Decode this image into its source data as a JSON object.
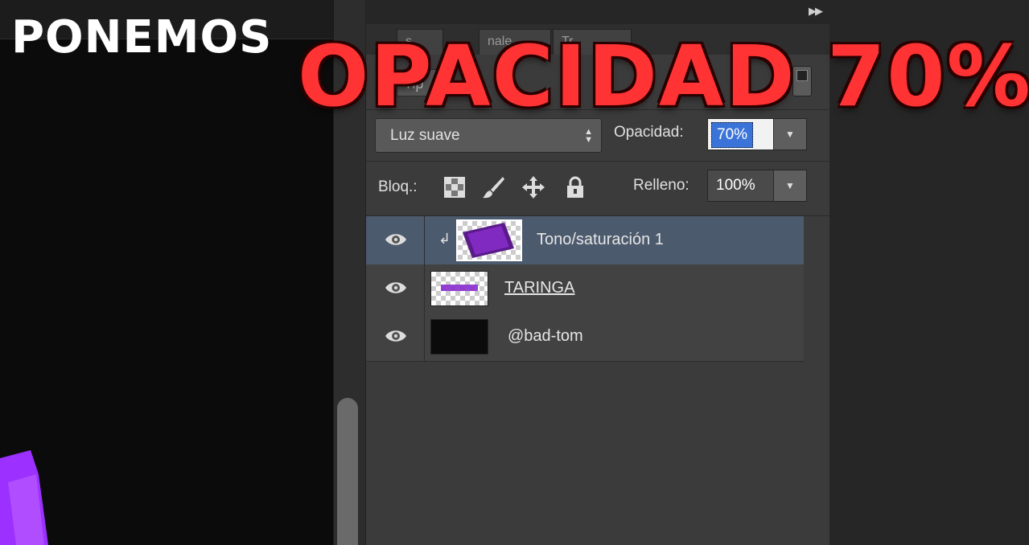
{
  "overlay": {
    "headline_white": "PONEMOS",
    "headline_red": "OPACIDAD 70%"
  },
  "panel": {
    "tabs": [
      "s",
      "nale",
      "Tr"
    ],
    "filter_label": "Tip",
    "blend_mode": "Luz suave",
    "opacity_label": "Opacidad:",
    "opacity_value": "70%",
    "lock_label": "Bloq.:",
    "fill_label": "Relleno:",
    "fill_value": "100%",
    "lock_icons": [
      "lock-transparent-pixels-icon",
      "lock-image-pixels-icon",
      "lock-position-icon",
      "lock-all-icon"
    ]
  },
  "layers": [
    {
      "name": "Tono/saturación 1",
      "selected": true,
      "clipped": true,
      "visible": true
    },
    {
      "name": "TARINGA",
      "selected": false,
      "clipped": false,
      "visible": true
    },
    {
      "name": "@bad-tom",
      "selected": false,
      "clipped": false,
      "visible": true
    }
  ],
  "colors": {
    "headline_red": "#ff3333",
    "selection_blue": "#3b74d8",
    "layer_selected": "#4c5a6e",
    "purple_accent": "#9b30ff"
  }
}
